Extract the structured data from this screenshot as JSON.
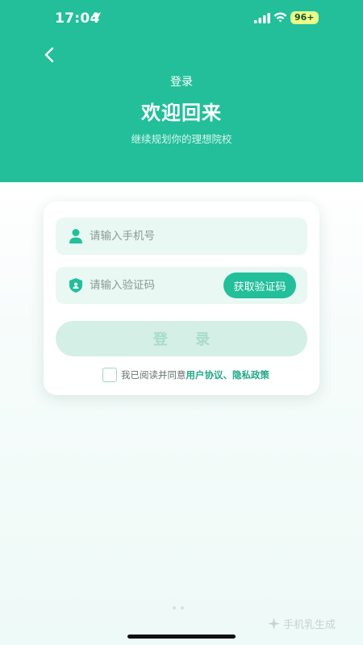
{
  "status_bar": {
    "time": "17:04",
    "battery": "96+",
    "icons": [
      "location-arrow-icon",
      "signal-icon",
      "wifi-icon"
    ]
  },
  "nav": {
    "back_icon": "chevron-left-icon",
    "title": "登录"
  },
  "hero": {
    "welcome": "欢迎回来",
    "subtitle": "继续规划你的理想院校"
  },
  "form": {
    "phone": {
      "icon": "user-icon",
      "value": "",
      "placeholder": "请输入手机号"
    },
    "code": {
      "icon": "shield-icon",
      "value": "",
      "placeholder": "请输入验证码",
      "get_code_label": "获取验证码"
    },
    "login_label": "登 录",
    "agreement": {
      "checked": false,
      "prefix": "我已阅读并同意",
      "user_agreement": "用户协议",
      "separator": "、",
      "privacy_policy": "隐私政策"
    }
  },
  "watermark": {
    "text": "手机乳生成"
  },
  "colors": {
    "primary": "#22bf9a",
    "field_bg": "#e9f8f3",
    "login_disabled_bg": "#d4efe6",
    "link": "#22a988"
  }
}
